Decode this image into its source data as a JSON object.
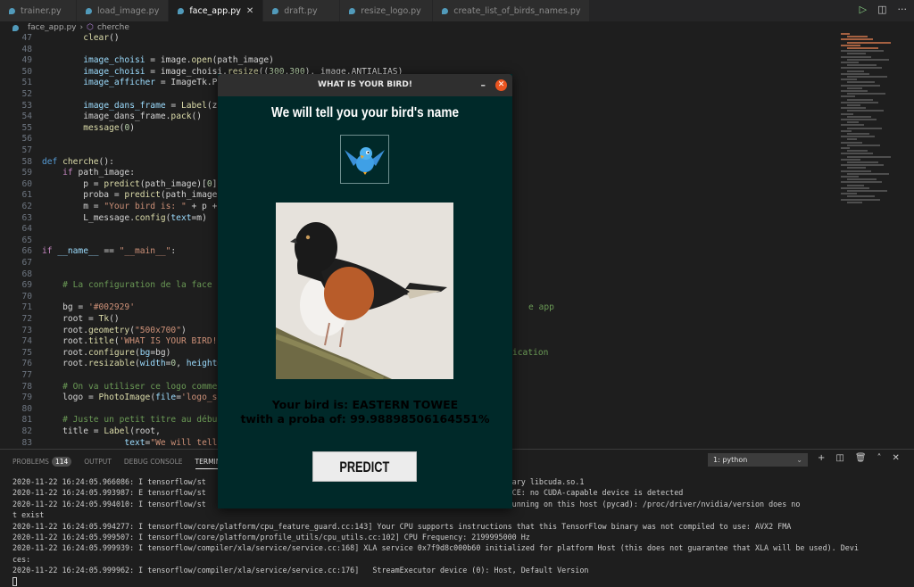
{
  "tabs": [
    {
      "label": "trainer.py"
    },
    {
      "label": "load_image.py"
    },
    {
      "label": "face_app.py",
      "active": true
    },
    {
      "label": "draft.py"
    },
    {
      "label": "resize_logo.py"
    },
    {
      "label": "create_list_of_birds_names.py"
    }
  ],
  "breadcrumb": {
    "file": "face_app.py",
    "symbol": "cherche"
  },
  "code": [
    {
      "n": "47",
      "s": [
        [
          "        ",
          "pl"
        ],
        [
          "clear",
          "fn"
        ],
        [
          "()",
          "pl"
        ]
      ]
    },
    {
      "n": "48",
      "s": []
    },
    {
      "n": "49",
      "s": [
        [
          "        ",
          "pl"
        ],
        [
          "image_choisi",
          "vr"
        ],
        [
          " = image.",
          "pl"
        ],
        [
          "open",
          "fn"
        ],
        [
          "(path_image)",
          "pl"
        ]
      ]
    },
    {
      "n": "50",
      "s": [
        [
          "        ",
          "pl"
        ],
        [
          "image_choisi",
          "vr"
        ],
        [
          " = image_choisi.",
          "pl"
        ],
        [
          "resize",
          "fn"
        ],
        [
          "((",
          "pl"
        ],
        [
          "300",
          "nm"
        ],
        [
          ",",
          "pl"
        ],
        [
          "300",
          "nm"
        ],
        [
          "), image.ANTIALIAS)",
          "pl"
        ]
      ]
    },
    {
      "n": "51",
      "s": [
        [
          "        ",
          "pl"
        ],
        [
          "image_afficher",
          "vr"
        ],
        [
          " = ImageTk.Ph",
          "pl"
        ]
      ]
    },
    {
      "n": "52",
      "s": []
    },
    {
      "n": "53",
      "s": [
        [
          "        ",
          "pl"
        ],
        [
          "image_dans_frame",
          "vr"
        ],
        [
          " = ",
          "pl"
        ],
        [
          "Label",
          "fn"
        ],
        [
          "(zo",
          "pl"
        ]
      ]
    },
    {
      "n": "54",
      "s": [
        [
          "        ",
          "pl"
        ],
        [
          "image_dans_frame.",
          "pl"
        ],
        [
          "pack",
          "fn"
        ],
        [
          "()",
          "pl"
        ]
      ]
    },
    {
      "n": "55",
      "s": [
        [
          "        ",
          "pl"
        ],
        [
          "message",
          "fn"
        ],
        [
          "(",
          "pl"
        ],
        [
          "0",
          "nm"
        ],
        [
          ")",
          "pl"
        ]
      ]
    },
    {
      "n": "56",
      "s": []
    },
    {
      "n": "57",
      "s": []
    },
    {
      "n": "58",
      "s": [
        [
          "def ",
          "kw"
        ],
        [
          "cherche",
          "fn"
        ],
        [
          "():",
          "pl"
        ]
      ]
    },
    {
      "n": "59",
      "s": [
        [
          "    ",
          "pl"
        ],
        [
          "if ",
          "ct"
        ],
        [
          "path_image:",
          "pl"
        ]
      ]
    },
    {
      "n": "60",
      "s": [
        [
          "        p = ",
          "pl"
        ],
        [
          "predict",
          "fn"
        ],
        [
          "(path_image)[",
          "pl"
        ],
        [
          "0",
          "nm"
        ],
        [
          "]",
          "pl"
        ]
      ]
    },
    {
      "n": "61",
      "s": [
        [
          "        proba = ",
          "pl"
        ],
        [
          "predict",
          "fn"
        ],
        [
          "(path_image)",
          "pl"
        ]
      ]
    },
    {
      "n": "62",
      "s": [
        [
          "        m = ",
          "pl"
        ],
        [
          "\"Your bird is: \"",
          "st"
        ],
        [
          " + p +",
          "pl"
        ]
      ]
    },
    {
      "n": "63",
      "s": [
        [
          "        L_message.",
          "pl"
        ],
        [
          "config",
          "fn"
        ],
        [
          "(",
          "pl"
        ],
        [
          "text",
          "vr"
        ],
        [
          "=m)",
          "pl"
        ]
      ]
    },
    {
      "n": "64",
      "s": []
    },
    {
      "n": "65",
      "s": []
    },
    {
      "n": "66",
      "s": [
        [
          "if ",
          "ct"
        ],
        [
          "__name__",
          "vr"
        ],
        [
          " == ",
          "pl"
        ],
        [
          "\"__main__\"",
          "st"
        ],
        [
          ":",
          "pl"
        ]
      ]
    },
    {
      "n": "67",
      "s": []
    },
    {
      "n": "68",
      "s": []
    },
    {
      "n": "69",
      "s": [
        [
          "    ",
          "pl"
        ],
        [
          "# La configuration de la face d",
          "cm"
        ]
      ]
    },
    {
      "n": "70",
      "s": []
    },
    {
      "n": "71",
      "s": [
        [
          "    bg = ",
          "pl"
        ],
        [
          "'#002929'",
          "st"
        ]
      ]
    },
    {
      "n": "72",
      "s": [
        [
          "    root = ",
          "pl"
        ],
        [
          "Tk",
          "fn"
        ],
        [
          "()",
          "pl"
        ]
      ]
    },
    {
      "n": "73",
      "s": [
        [
          "    root.",
          "pl"
        ],
        [
          "geometry",
          "fn"
        ],
        [
          "(",
          "pl"
        ],
        [
          "\"500x700\"",
          "st"
        ],
        [
          ")",
          "pl"
        ]
      ]
    },
    {
      "n": "74",
      "s": [
        [
          "    root.",
          "pl"
        ],
        [
          "title",
          "fn"
        ],
        [
          "(",
          "pl"
        ],
        [
          "'WHAT IS YOUR BIRD!'",
          "st"
        ]
      ]
    },
    {
      "n": "75",
      "s": [
        [
          "    root.",
          "pl"
        ],
        [
          "configure",
          "fn"
        ],
        [
          "(",
          "pl"
        ],
        [
          "bg",
          "vr"
        ],
        [
          "=bg)",
          "pl"
        ]
      ]
    },
    {
      "n": "76",
      "s": [
        [
          "    root.",
          "pl"
        ],
        [
          "resizable",
          "fn"
        ],
        [
          "(",
          "pl"
        ],
        [
          "width",
          "vr"
        ],
        [
          "=",
          "pl"
        ],
        [
          "0",
          "nm"
        ],
        [
          ", ",
          "pl"
        ],
        [
          "height",
          "vr"
        ],
        [
          "=",
          "pl"
        ]
      ]
    },
    {
      "n": "77",
      "s": []
    },
    {
      "n": "78",
      "s": [
        [
          "    ",
          "pl"
        ],
        [
          "# On va utiliser ce logo comme",
          "cm"
        ]
      ]
    },
    {
      "n": "79",
      "s": [
        [
          "    logo = ",
          "pl"
        ],
        [
          "PhotoImage",
          "fn"
        ],
        [
          "(",
          "pl"
        ],
        [
          "file",
          "vr"
        ],
        [
          "=",
          "pl"
        ],
        [
          "'logo_s.",
          "st"
        ]
      ]
    },
    {
      "n": "80",
      "s": []
    },
    {
      "n": "81",
      "s": [
        [
          "    ",
          "pl"
        ],
        [
          "# Juste un petit titre au début",
          "cm"
        ]
      ]
    },
    {
      "n": "82",
      "s": [
        [
          "    title = ",
          "pl"
        ],
        [
          "Label",
          "fn"
        ],
        [
          "(root,",
          "pl"
        ]
      ]
    },
    {
      "n": "83",
      "s": [
        [
          "                ",
          "pl"
        ],
        [
          "text",
          "vr"
        ],
        [
          "=",
          "pl"
        ],
        [
          "\"We will tell",
          "st"
        ]
      ]
    }
  ],
  "code_fragments": [
    {
      "line": "71",
      "text": "e app"
    },
    {
      "line": "75",
      "text": "ication"
    }
  ],
  "panel": {
    "tabs": [
      {
        "label": "PROBLEMS",
        "badge": "114"
      },
      {
        "label": "OUTPUT"
      },
      {
        "label": "DEBUG CONSOLE"
      },
      {
        "label": "TERMINAL",
        "active": true
      }
    ],
    "terminal_select": "1: python",
    "terminal_lines": [
      "2020-11-22 16:24:05.966086: I tensorflow/st                                                  pened dynamic library libcuda.so.1",
      "2020-11-22 16:24:05.993987: E tensorflow/st                                                  CUDA_ERROR_NO_DEVICE: no CUDA-capable device is detected",
      "2020-11-22 16:24:05.994010: I tensorflow/st                                                  not appear to be running on this host (pycad): /proc/driver/nvidia/version does no",
      "t exist",
      "2020-11-22 16:24:05.994277: I tensorflow/core/platform/cpu_feature_guard.cc:143] Your CPU supports instructions that this TensorFlow binary was not compiled to use: AVX2 FMA",
      "2020-11-22 16:24:05.999507: I tensorflow/core/platform/profile_utils/cpu_utils.cc:102] CPU Frequency: 2199995000 Hz",
      "2020-11-22 16:24:05.999939: I tensorflow/compiler/xla/service/service.cc:168] XLA service 0x7f9d8c000b60 initialized for platform Host (this does not guarantee that XLA will be used). Devi",
      "ces:",
      "2020-11-22 16:24:05.999962: I tensorflow/compiler/xla/service/service.cc:176]   StreamExecutor device (0): Host, Default Version"
    ]
  },
  "dialog": {
    "title": "WHAT IS YOUR BIRD!",
    "heading": "We will tell you your bird's name",
    "result_line1": "Your bird is: EASTERN TOWEE",
    "result_line2": "twith a proba of: 99.98898506164551%",
    "predict_label": "PREDICT",
    "bg_color": "#002929",
    "close_color": "#e95420"
  }
}
